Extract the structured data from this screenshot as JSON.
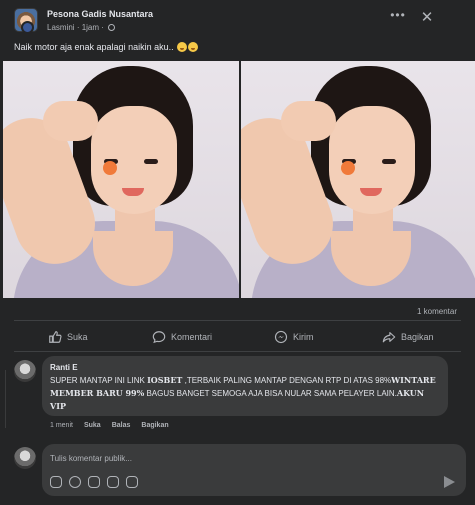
{
  "post": {
    "group_name": "Pesona Gadis Nusantara",
    "author": "Lasmini",
    "time": "1jam",
    "caption": "Naik motor aja enak apalagi naikin aku..",
    "comment_count": "1 komentar"
  },
  "actions": {
    "like": "Suka",
    "comment": "Komentari",
    "send": "Kirim",
    "share": "Bagikan"
  },
  "comment": {
    "author": "Ranti E",
    "text_1": "SUPER MANTAP INI LINK ",
    "bold_1": "IOSBET",
    "text_2": " ,TERBAIK PALING MANTAP DENGAN RTP DI ATAS 98%",
    "bold_2": "WINTARE MEMBER BARU 99%",
    "text_3": " BAGUS BANGET SEMOGA AJA BISA NULAR SAMA PELAYER LAIN.",
    "bold_3": "AKUN VIP",
    "time": "1 menit",
    "like": "Suka",
    "reply": "Balas",
    "share": "Bagikan"
  },
  "composer": {
    "placeholder": "Tulis komentar publik..."
  },
  "colors": {
    "background": "#242526",
    "bubble": "#3a3b3c",
    "text": "#e4e6eb",
    "muted": "#b0b3b8"
  },
  "icons": [
    "more-icon",
    "close-icon",
    "globe-icon",
    "like-icon",
    "comment-icon",
    "messenger-icon",
    "share-icon",
    "send-icon"
  ]
}
